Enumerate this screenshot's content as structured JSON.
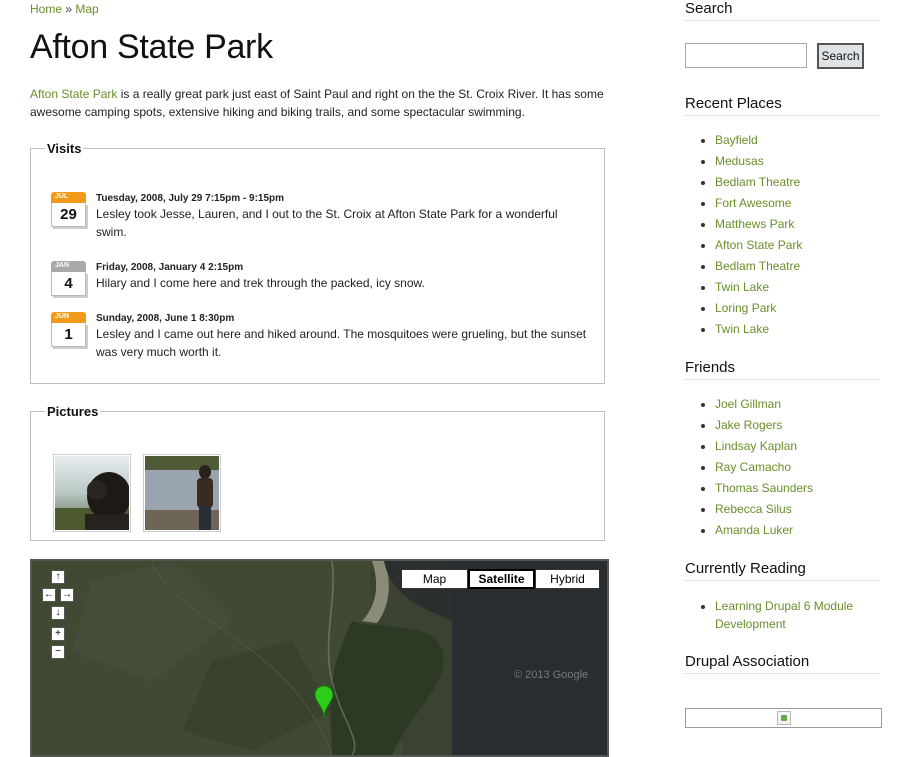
{
  "breadcrumb": {
    "home": "Home",
    "separator": "»",
    "map": "Map"
  },
  "page": {
    "title": "Afton State Park",
    "intro_link": "Afton State Park",
    "intro_text": " is a really great park just east of Saint Paul and right on the the St. Croix River. It has some awesome camping spots, extensive hiking and biking trails, and some spectacular swimming."
  },
  "visits": {
    "legend": "Visits",
    "items": [
      {
        "month": "JUL",
        "day": "29",
        "color": "#f29a1a",
        "date": "Tuesday, 2008, July 29 7:15pm - 9:15pm",
        "text": "Lesley took Jesse, Lauren, and I out to the St. Croix at Afton State Park for a wonderful swim."
      },
      {
        "month": "JAN",
        "day": "4",
        "color": "#a9a9a9",
        "date": "Friday, 2008, January 4 2:15pm",
        "text": "Hilary and I come here and trek through the packed, icy snow."
      },
      {
        "month": "JUN",
        "day": "1",
        "color": "#f29a1a",
        "date": "Sunday, 2008, June 1 8:30pm",
        "text": "Lesley and I came out here and hiked around. The mosquitoes were grueling, but the sunset was very much worth it."
      }
    ]
  },
  "pictures": {
    "legend": "Pictures"
  },
  "map": {
    "types": [
      "Map",
      "Satellite",
      "Hybrid"
    ],
    "active_type": "Satellite",
    "copyright": "© 2013 Google",
    "controls": {
      "up": "↑",
      "left": "←",
      "right": "→",
      "down": "↓",
      "zoom_in": "+",
      "zoom_out": "−"
    }
  },
  "sidebar": {
    "search": {
      "title": "Search",
      "placeholder": "",
      "button": "Search"
    },
    "recent_places": {
      "title": "Recent Places",
      "items": [
        "Bayfield",
        "Medusas",
        "Bedlam Theatre",
        "Fort Awesome",
        "Matthews Park",
        "Afton State Park",
        "Bedlam Theatre",
        "Twin Lake",
        "Loring Park",
        "Twin Lake"
      ]
    },
    "friends": {
      "title": "Friends",
      "items": [
        "Joel Gillman",
        "Jake Rogers",
        "Lindsay Kaplan",
        "Ray Camacho",
        "Thomas Saunders",
        "Rebecca Silus",
        "Amanda Luker"
      ]
    },
    "currently_reading": {
      "title": "Currently Reading",
      "items": [
        "Learning Drupal 6 Module Development"
      ]
    },
    "drupal_association": {
      "title": "Drupal Association"
    }
  },
  "colors": {
    "link": "#6a8f2a",
    "calendar_orange": "#f29a1a",
    "calendar_gray": "#a9a9a9",
    "marker": "#2ecc1a"
  }
}
